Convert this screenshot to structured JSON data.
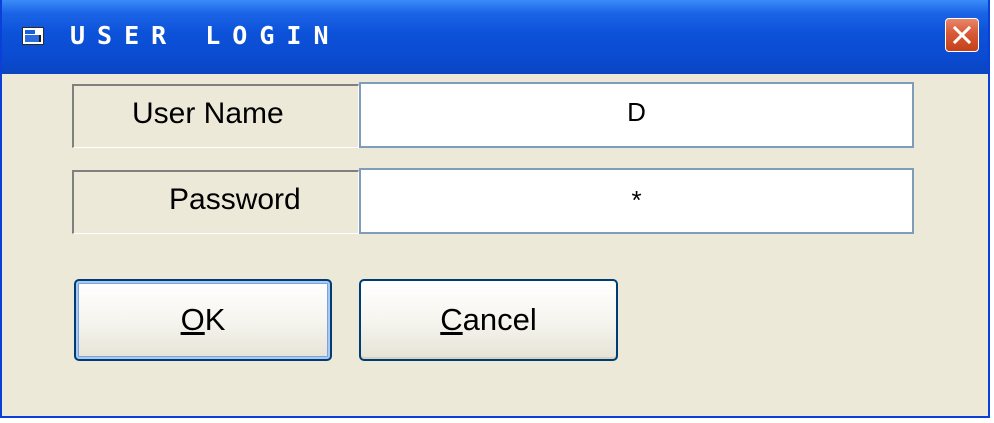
{
  "window": {
    "title": "USER LOGIN",
    "close_icon": "close-x-icon"
  },
  "form": {
    "username_label": "User Name",
    "username_value": "D",
    "password_label": "Password",
    "password_value": "*"
  },
  "buttons": {
    "ok": {
      "mnemonic": "O",
      "rest": "K"
    },
    "cancel": {
      "mnemonic": "C",
      "rest": "ancel"
    }
  },
  "colors": {
    "titlebar": "#0A4AD0",
    "window_bg": "#ECE9D8",
    "close_button": "#D85A36",
    "field_border": "#7F9DB9"
  }
}
